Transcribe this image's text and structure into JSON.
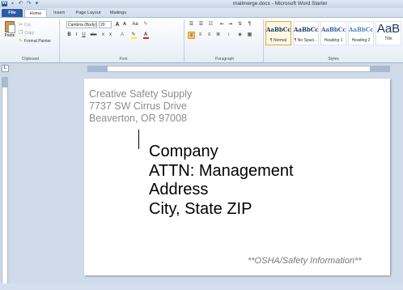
{
  "window": {
    "title": "mailmerge.docx - Microsoft Word Starter"
  },
  "quick_access": {
    "icons": [
      "word-logo-icon",
      "save-icon",
      "undo-icon",
      "redo-icon",
      "customize-icon"
    ]
  },
  "tabs": {
    "file": "File",
    "home": "Home",
    "insert": "Insert",
    "page_layout": "Page Layout",
    "mailings": "Mailings"
  },
  "clipboard": {
    "paste": "Paste",
    "cut": "Cut",
    "copy": "Copy",
    "format_painter": "Format Painter",
    "group_label": "Clipboard"
  },
  "font": {
    "font_name": "Cambria (Body)",
    "font_size": "20",
    "grow": "A",
    "shrink": "A",
    "change_case": "Aa",
    "bold": "B",
    "italic": "I",
    "underline": "U",
    "strikethrough": "abc",
    "subscript": "x",
    "superscript": "x",
    "highlight_color": "#f7f300",
    "font_color": "#e02020",
    "group_label": "Font"
  },
  "paragraph": {
    "group_label": "Paragraph"
  },
  "styles": {
    "group_label": "Styles",
    "items": [
      {
        "sample": "AaBbCcI",
        "name": "¶ Normal"
      },
      {
        "sample": "AaBbCcI",
        "name": "¶ No Spaci..."
      },
      {
        "sample": "AaBbCc",
        "name": "Heading 1"
      },
      {
        "sample": "AaBbCcI",
        "name": "Heading 2"
      },
      {
        "sample": "AaB",
        "name": "Title"
      }
    ]
  },
  "document": {
    "return_address": [
      "Creative Safety Supply",
      "7737 SW Cirrus Drive",
      "Beaverton, OR 97008"
    ],
    "recipient": [
      "Company",
      "ATTN: Management",
      "Address",
      "City, State ZIP"
    ],
    "footer_note": "**OSHA/Safety Information**"
  }
}
